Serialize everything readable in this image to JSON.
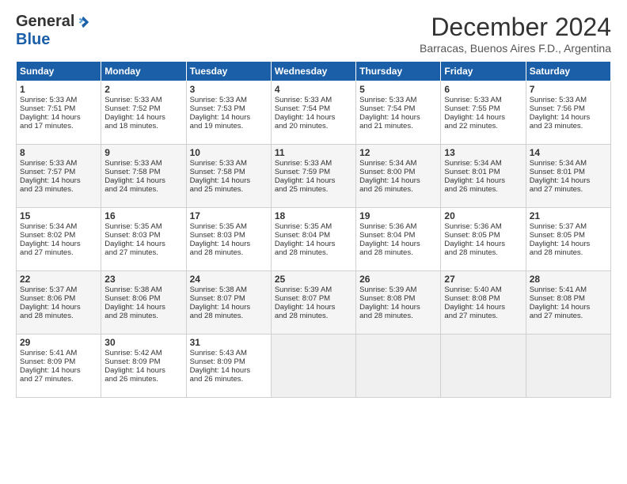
{
  "logo": {
    "general": "General",
    "blue": "Blue"
  },
  "title": "December 2024",
  "subtitle": "Barracas, Buenos Aires F.D., Argentina",
  "weekdays": [
    "Sunday",
    "Monday",
    "Tuesday",
    "Wednesday",
    "Thursday",
    "Friday",
    "Saturday"
  ],
  "weeks": [
    [
      {
        "day": 1,
        "lines": [
          "Sunrise: 5:33 AM",
          "Sunset: 7:51 PM",
          "Daylight: 14 hours",
          "and 17 minutes."
        ]
      },
      {
        "day": 2,
        "lines": [
          "Sunrise: 5:33 AM",
          "Sunset: 7:52 PM",
          "Daylight: 14 hours",
          "and 18 minutes."
        ]
      },
      {
        "day": 3,
        "lines": [
          "Sunrise: 5:33 AM",
          "Sunset: 7:53 PM",
          "Daylight: 14 hours",
          "and 19 minutes."
        ]
      },
      {
        "day": 4,
        "lines": [
          "Sunrise: 5:33 AM",
          "Sunset: 7:54 PM",
          "Daylight: 14 hours",
          "and 20 minutes."
        ]
      },
      {
        "day": 5,
        "lines": [
          "Sunrise: 5:33 AM",
          "Sunset: 7:54 PM",
          "Daylight: 14 hours",
          "and 21 minutes."
        ]
      },
      {
        "day": 6,
        "lines": [
          "Sunrise: 5:33 AM",
          "Sunset: 7:55 PM",
          "Daylight: 14 hours",
          "and 22 minutes."
        ]
      },
      {
        "day": 7,
        "lines": [
          "Sunrise: 5:33 AM",
          "Sunset: 7:56 PM",
          "Daylight: 14 hours",
          "and 23 minutes."
        ]
      }
    ],
    [
      {
        "day": 8,
        "lines": [
          "Sunrise: 5:33 AM",
          "Sunset: 7:57 PM",
          "Daylight: 14 hours",
          "and 23 minutes."
        ]
      },
      {
        "day": 9,
        "lines": [
          "Sunrise: 5:33 AM",
          "Sunset: 7:58 PM",
          "Daylight: 14 hours",
          "and 24 minutes."
        ]
      },
      {
        "day": 10,
        "lines": [
          "Sunrise: 5:33 AM",
          "Sunset: 7:58 PM",
          "Daylight: 14 hours",
          "and 25 minutes."
        ]
      },
      {
        "day": 11,
        "lines": [
          "Sunrise: 5:33 AM",
          "Sunset: 7:59 PM",
          "Daylight: 14 hours",
          "and 25 minutes."
        ]
      },
      {
        "day": 12,
        "lines": [
          "Sunrise: 5:34 AM",
          "Sunset: 8:00 PM",
          "Daylight: 14 hours",
          "and 26 minutes."
        ]
      },
      {
        "day": 13,
        "lines": [
          "Sunrise: 5:34 AM",
          "Sunset: 8:01 PM",
          "Daylight: 14 hours",
          "and 26 minutes."
        ]
      },
      {
        "day": 14,
        "lines": [
          "Sunrise: 5:34 AM",
          "Sunset: 8:01 PM",
          "Daylight: 14 hours",
          "and 27 minutes."
        ]
      }
    ],
    [
      {
        "day": 15,
        "lines": [
          "Sunrise: 5:34 AM",
          "Sunset: 8:02 PM",
          "Daylight: 14 hours",
          "and 27 minutes."
        ]
      },
      {
        "day": 16,
        "lines": [
          "Sunrise: 5:35 AM",
          "Sunset: 8:03 PM",
          "Daylight: 14 hours",
          "and 27 minutes."
        ]
      },
      {
        "day": 17,
        "lines": [
          "Sunrise: 5:35 AM",
          "Sunset: 8:03 PM",
          "Daylight: 14 hours",
          "and 28 minutes."
        ]
      },
      {
        "day": 18,
        "lines": [
          "Sunrise: 5:35 AM",
          "Sunset: 8:04 PM",
          "Daylight: 14 hours",
          "and 28 minutes."
        ]
      },
      {
        "day": 19,
        "lines": [
          "Sunrise: 5:36 AM",
          "Sunset: 8:04 PM",
          "Daylight: 14 hours",
          "and 28 minutes."
        ]
      },
      {
        "day": 20,
        "lines": [
          "Sunrise: 5:36 AM",
          "Sunset: 8:05 PM",
          "Daylight: 14 hours",
          "and 28 minutes."
        ]
      },
      {
        "day": 21,
        "lines": [
          "Sunrise: 5:37 AM",
          "Sunset: 8:05 PM",
          "Daylight: 14 hours",
          "and 28 minutes."
        ]
      }
    ],
    [
      {
        "day": 22,
        "lines": [
          "Sunrise: 5:37 AM",
          "Sunset: 8:06 PM",
          "Daylight: 14 hours",
          "and 28 minutes."
        ]
      },
      {
        "day": 23,
        "lines": [
          "Sunrise: 5:38 AM",
          "Sunset: 8:06 PM",
          "Daylight: 14 hours",
          "and 28 minutes."
        ]
      },
      {
        "day": 24,
        "lines": [
          "Sunrise: 5:38 AM",
          "Sunset: 8:07 PM",
          "Daylight: 14 hours",
          "and 28 minutes."
        ]
      },
      {
        "day": 25,
        "lines": [
          "Sunrise: 5:39 AM",
          "Sunset: 8:07 PM",
          "Daylight: 14 hours",
          "and 28 minutes."
        ]
      },
      {
        "day": 26,
        "lines": [
          "Sunrise: 5:39 AM",
          "Sunset: 8:08 PM",
          "Daylight: 14 hours",
          "and 28 minutes."
        ]
      },
      {
        "day": 27,
        "lines": [
          "Sunrise: 5:40 AM",
          "Sunset: 8:08 PM",
          "Daylight: 14 hours",
          "and 27 minutes."
        ]
      },
      {
        "day": 28,
        "lines": [
          "Sunrise: 5:41 AM",
          "Sunset: 8:08 PM",
          "Daylight: 14 hours",
          "and 27 minutes."
        ]
      }
    ],
    [
      {
        "day": 29,
        "lines": [
          "Sunrise: 5:41 AM",
          "Sunset: 8:09 PM",
          "Daylight: 14 hours",
          "and 27 minutes."
        ]
      },
      {
        "day": 30,
        "lines": [
          "Sunrise: 5:42 AM",
          "Sunset: 8:09 PM",
          "Daylight: 14 hours",
          "and 26 minutes."
        ]
      },
      {
        "day": 31,
        "lines": [
          "Sunrise: 5:43 AM",
          "Sunset: 8:09 PM",
          "Daylight: 14 hours",
          "and 26 minutes."
        ]
      },
      null,
      null,
      null,
      null
    ]
  ]
}
